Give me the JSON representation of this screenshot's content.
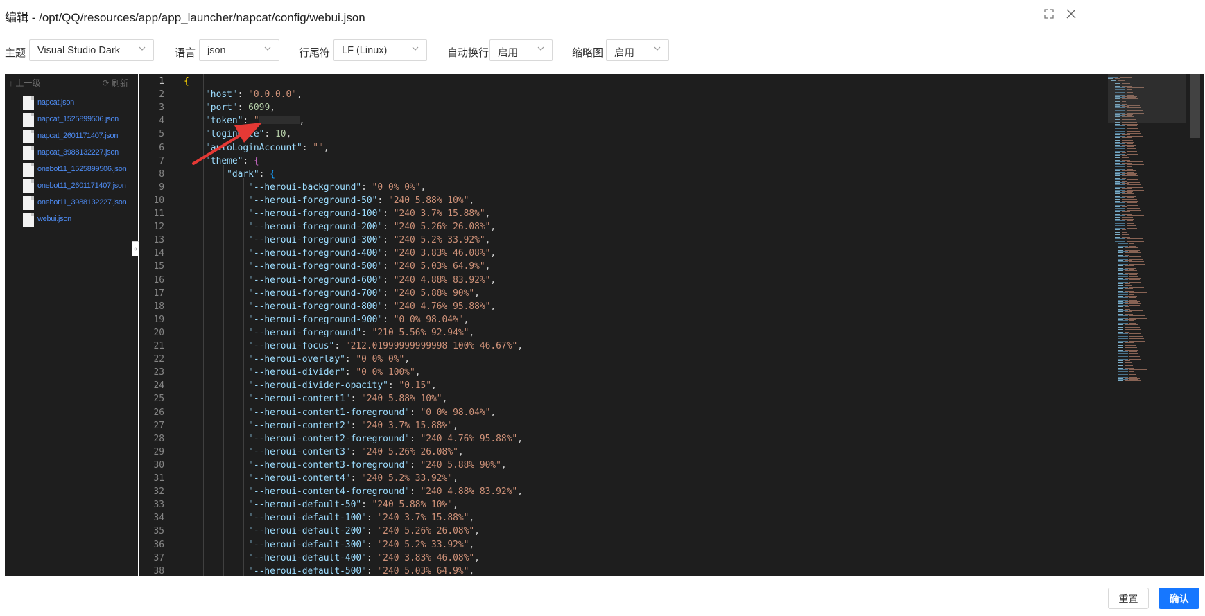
{
  "window": {
    "title": "编辑 - /opt/QQ/resources/app/app_launcher/napcat/config/webui.json",
    "maximize_icon": "maximize-icon",
    "close_icon": "close-icon"
  },
  "toolbar": {
    "theme": {
      "label": "主题",
      "value": "Visual Studio Dark"
    },
    "language": {
      "label": "语言",
      "value": "json"
    },
    "eol": {
      "label": "行尾符",
      "value": "LF (Linux)"
    },
    "wrap": {
      "label": "自动换行",
      "value": "启用"
    },
    "minimap": {
      "label": "缩略图",
      "value": "启用"
    }
  },
  "sidebar": {
    "up_label": "↑ 上一级",
    "refresh_label": "⟳ 刷新",
    "files": [
      "napcat.json",
      "napcat_1525899506.json",
      "napcat_2601171407.json",
      "napcat_3988132227.json",
      "onebot11_1525899506.json",
      "onebot11_2601171407.json",
      "onebot11_3988132227.json",
      "webui.json"
    ],
    "collapse_icon": "collapse-left-icon"
  },
  "editor": {
    "current_line": 1,
    "lines": [
      {
        "n": "1",
        "t": "{"
      },
      {
        "n": "2",
        "t": "    \"host\": \"0.0.0.0\","
      },
      {
        "n": "3",
        "t": "    \"port\": 6099,"
      },
      {
        "n": "4",
        "t": "    \"token\": \"",
        "masked": true
      },
      {
        "n": "5",
        "t": "    \"loginRate\": 10,"
      },
      {
        "n": "6",
        "t": "    \"autoLoginAccount\": \"\","
      },
      {
        "n": "7",
        "t": "    \"theme\": {"
      },
      {
        "n": "8",
        "t": "        \"dark\": {"
      },
      {
        "n": "9",
        "t": "            \"--heroui-background\": \"0 0% 0%\","
      },
      {
        "n": "10",
        "t": "            \"--heroui-foreground-50\": \"240 5.88% 10%\","
      },
      {
        "n": "11",
        "t": "            \"--heroui-foreground-100\": \"240 3.7% 15.88%\","
      },
      {
        "n": "12",
        "t": "            \"--heroui-foreground-200\": \"240 5.26% 26.08%\","
      },
      {
        "n": "13",
        "t": "            \"--heroui-foreground-300\": \"240 5.2% 33.92%\","
      },
      {
        "n": "14",
        "t": "            \"--heroui-foreground-400\": \"240 3.83% 46.08%\","
      },
      {
        "n": "15",
        "t": "            \"--heroui-foreground-500\": \"240 5.03% 64.9%\","
      },
      {
        "n": "16",
        "t": "            \"--heroui-foreground-600\": \"240 4.88% 83.92%\","
      },
      {
        "n": "17",
        "t": "            \"--heroui-foreground-700\": \"240 5.88% 90%\","
      },
      {
        "n": "18",
        "t": "            \"--heroui-foreground-800\": \"240 4.76% 95.88%\","
      },
      {
        "n": "19",
        "t": "            \"--heroui-foreground-900\": \"0 0% 98.04%\","
      },
      {
        "n": "20",
        "t": "            \"--heroui-foreground\": \"210 5.56% 92.94%\","
      },
      {
        "n": "21",
        "t": "            \"--heroui-focus\": \"212.01999999999998 100% 46.67%\","
      },
      {
        "n": "22",
        "t": "            \"--heroui-overlay\": \"0 0% 0%\","
      },
      {
        "n": "23",
        "t": "            \"--heroui-divider\": \"0 0% 100%\","
      },
      {
        "n": "24",
        "t": "            \"--heroui-divider-opacity\": \"0.15\","
      },
      {
        "n": "25",
        "t": "            \"--heroui-content1\": \"240 5.88% 10%\","
      },
      {
        "n": "26",
        "t": "            \"--heroui-content1-foreground\": \"0 0% 98.04%\","
      },
      {
        "n": "27",
        "t": "            \"--heroui-content2\": \"240 3.7% 15.88%\","
      },
      {
        "n": "28",
        "t": "            \"--heroui-content2-foreground\": \"240 4.76% 95.88%\","
      },
      {
        "n": "29",
        "t": "            \"--heroui-content3\": \"240 5.26% 26.08%\","
      },
      {
        "n": "30",
        "t": "            \"--heroui-content3-foreground\": \"240 5.88% 90%\","
      },
      {
        "n": "31",
        "t": "            \"--heroui-content4\": \"240 5.2% 33.92%\","
      },
      {
        "n": "32",
        "t": "            \"--heroui-content4-foreground\": \"240 4.88% 83.92%\","
      },
      {
        "n": "33",
        "t": "            \"--heroui-default-50\": \"240 5.88% 10%\","
      },
      {
        "n": "34",
        "t": "            \"--heroui-default-100\": \"240 3.7% 15.88%\","
      },
      {
        "n": "35",
        "t": "            \"--heroui-default-200\": \"240 5.26% 26.08%\","
      },
      {
        "n": "36",
        "t": "            \"--heroui-default-300\": \"240 5.2% 33.92%\","
      },
      {
        "n": "37",
        "t": "            \"--heroui-default-400\": \"240 3.83% 46.08%\","
      },
      {
        "n": "38",
        "t": "            \"--heroui-default-500\": \"240 5.03% 64.9%\","
      }
    ]
  },
  "footer": {
    "reset_label": "重置",
    "ok_label": "确认"
  },
  "colors": {
    "editor_bg": "#1e1e1e",
    "key": "#9cdcfe",
    "string": "#ce9178",
    "number": "#b5cea8",
    "primary": "#1677ff",
    "annotation_arrow": "#e53935"
  }
}
